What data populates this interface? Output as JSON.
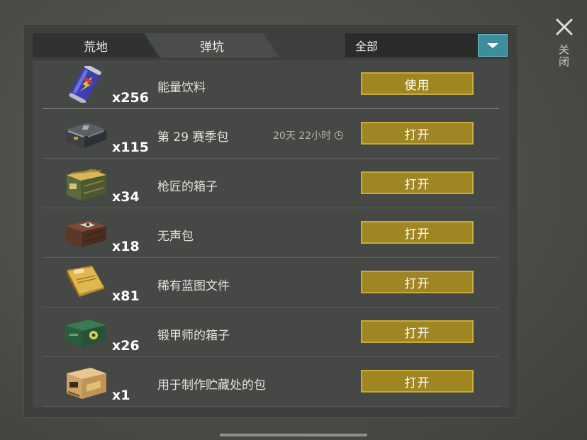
{
  "tabs": [
    {
      "label": "荒地",
      "active": true
    },
    {
      "label": "弹坑",
      "active": false
    }
  ],
  "filter": {
    "selected": "全部"
  },
  "close_label": "关闭",
  "items": [
    {
      "icon": "energy-drink-can-icon",
      "qty": "x256",
      "name": "能量饮料",
      "timer": "",
      "action": "使用"
    },
    {
      "icon": "season-pack-case-icon",
      "qty": "x115",
      "name": "第 29 赛季包",
      "timer": "20天 22小时",
      "action": "打开"
    },
    {
      "icon": "gunsmith-crate-icon",
      "qty": "x34",
      "name": "枪匠的箱子",
      "timer": "",
      "action": "打开"
    },
    {
      "icon": "silent-pack-crate-icon",
      "qty": "x18",
      "name": "无声包",
      "timer": "",
      "action": "打开"
    },
    {
      "icon": "blueprint-folder-icon",
      "qty": "x81",
      "name": "稀有蓝图文件",
      "timer": "",
      "action": "打开"
    },
    {
      "icon": "armorer-crate-icon",
      "qty": "x26",
      "name": "锻甲师的箱子",
      "timer": "",
      "action": "打开"
    },
    {
      "icon": "stash-pack-box-icon",
      "qty": "x1",
      "name": "用于制作贮藏处的包",
      "timer": "",
      "action": "打开"
    }
  ],
  "colors": {
    "button": "#a08622",
    "button_border": "#c7ab3e",
    "dropdown": "#3e8d9c",
    "panel": "#3d403d"
  }
}
